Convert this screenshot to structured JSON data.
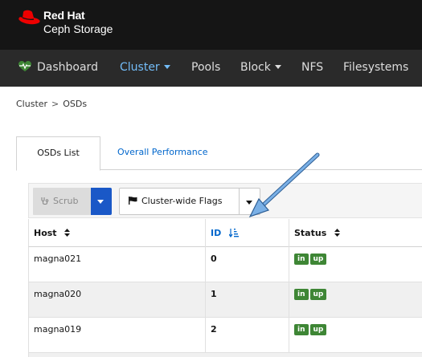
{
  "brand": {
    "name": "Red Hat",
    "product": "Ceph Storage"
  },
  "nav": {
    "dashboard": "Dashboard",
    "cluster": "Cluster",
    "pools": "Pools",
    "block": "Block",
    "nfs": "NFS",
    "filesystems": "Filesystems"
  },
  "breadcrumb": {
    "parent": "Cluster",
    "separator": ">",
    "current": "OSDs"
  },
  "tabs": {
    "osds_list": "OSDs List",
    "overall_performance": "Overall Performance"
  },
  "toolbar": {
    "scrub_label": "Scrub",
    "flags_label": "Cluster-wide Flags"
  },
  "table": {
    "columns": {
      "host": "Host",
      "id": "ID",
      "status": "Status"
    },
    "rows": [
      {
        "host": "magna021",
        "id": "0",
        "status": [
          "in",
          "up"
        ]
      },
      {
        "host": "magna020",
        "id": "1",
        "status": [
          "in",
          "up"
        ]
      },
      {
        "host": "magna019",
        "id": "2",
        "status": [
          "in",
          "up"
        ]
      }
    ]
  },
  "colors": {
    "masthead": "#151515",
    "nav_bg": "#2a2a2a",
    "nav_active": "#73bcf7",
    "accent_blue": "#1a58c7",
    "link": "#0066cc",
    "status_green": "#3e8635",
    "brand_red": "#ee0000",
    "annotation_arrow": "#5b9bd5"
  },
  "icons": {
    "logo": "red-hat-fedora-icon",
    "dashboard": "heartbeat-icon",
    "scrub": "stethoscope-icon",
    "flags": "flag-icon",
    "sort": "sort-icon",
    "id_sort": "sort-amount-asc-icon"
  }
}
